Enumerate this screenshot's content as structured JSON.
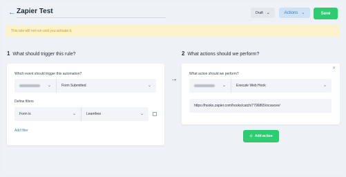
{
  "header": {
    "title": "Zapier Test",
    "draft_label": "Draft",
    "actions_label": "Actions",
    "save_label": "Save"
  },
  "warning": {
    "text": "This rule will not run until you activate it."
  },
  "trigger": {
    "number": "1",
    "title": "What should trigger this rule?",
    "event_question": "Which event should trigger this automation?",
    "event_value": "Form Submitted",
    "filters_label": "Define filters",
    "filter_operator": "Form is",
    "filter_value": "Leamfree",
    "add_filter_label": "Add filter"
  },
  "actions_section": {
    "number": "2",
    "title": "What actions should we perform?",
    "question": "What action should we perform?",
    "action_value": "Execute Web Hook",
    "webhook_url": "https://hooks.zapier.com/hooks/catch/7796865/ocswcev/",
    "add_action_label": "Add action"
  },
  "icons": {
    "back": "arrow-left-icon",
    "chevron": "chevron-down-icon",
    "arrow": "arrow-right-icon",
    "close": "close-icon",
    "trash": "trash-icon",
    "plus": "plus-icon"
  },
  "colors": {
    "accent_green": "#2ecc71",
    "accent_blue": "#3b82c4",
    "warning_bg": "#fbf2cc",
    "warning_text": "#d39b1f"
  }
}
